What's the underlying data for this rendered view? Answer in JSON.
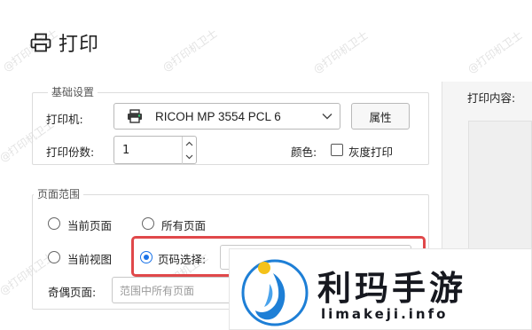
{
  "title": "打印",
  "watermark_text": "@打印机卫士",
  "basic": {
    "legend": "基础设置",
    "printer_label": "打印机:",
    "printer_value": "RICOH MP 3554 PCL 6",
    "properties_button": "属性",
    "copies_label": "打印份数:",
    "copies_value": "1",
    "color_label": "颜色:",
    "grayscale_label": "灰度打印",
    "grayscale_checked": false
  },
  "page_range": {
    "legend": "页面范围",
    "options": {
      "current_page": "当前页面",
      "all_pages": "所有页面",
      "current_view": "当前视图",
      "page_select": "页码选择:"
    },
    "selected": "page_select",
    "odd_even_label": "奇偶页面:",
    "odd_even_placeholder": "范围中所有页面"
  },
  "right_panel": {
    "content_label": "打印内容:"
  },
  "overlay": {
    "brand_name": "利玛手游",
    "brand_url": "limakeji.info"
  },
  "colors": {
    "highlight_border": "#e0484a",
    "accent": "#1a73e8",
    "logo_blue": "#1e7fd6",
    "logo_yellow": "#f4c21a"
  }
}
